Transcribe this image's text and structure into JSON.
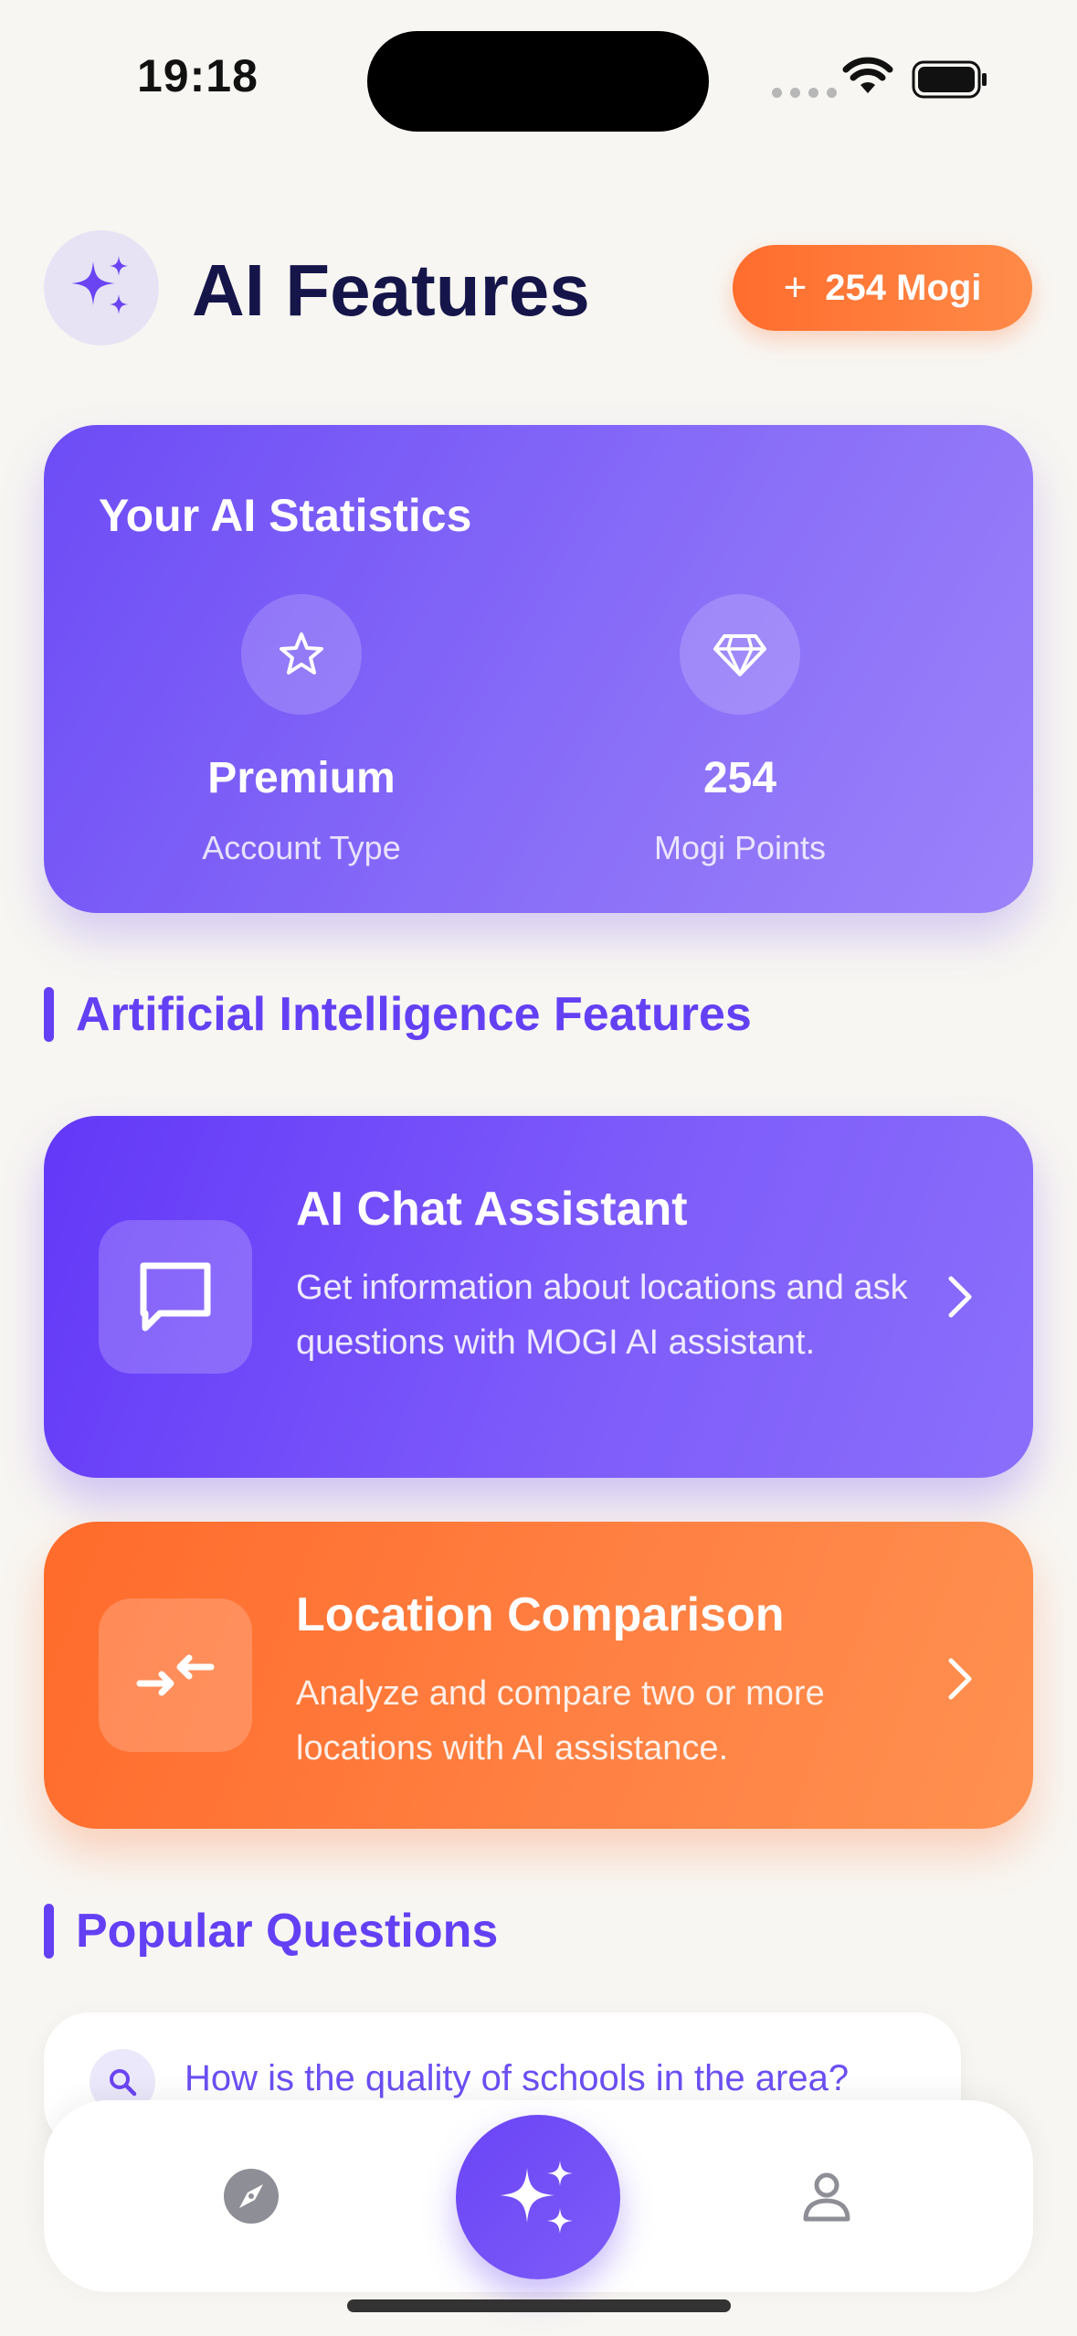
{
  "status_bar": {
    "time": "19:18"
  },
  "header": {
    "title": "AI Features",
    "mogi_button_label": "254 Mogi",
    "icon": "sparkles-icon"
  },
  "stats": {
    "title": "Your AI Statistics",
    "items": [
      {
        "icon": "star-icon",
        "value": "Premium",
        "label": "Account Type"
      },
      {
        "icon": "diamond-icon",
        "value": "254",
        "label": "Mogi Points"
      }
    ]
  },
  "sections": {
    "ai_features_title": "Artificial Intelligence Features",
    "popular_title": "Popular Questions"
  },
  "features": [
    {
      "icon": "chat-bubble-icon",
      "title": "AI Chat Assistant",
      "description": "Get information about locations and ask questions with MOGI AI assistant."
    },
    {
      "icon": "compare-arrows-icon",
      "title": "Location Comparison",
      "description": "Analyze and compare two or more locations with AI assistance."
    }
  ],
  "popular_questions": [
    {
      "icon": "search-icon",
      "text": "How is the quality of schools in the area?"
    }
  ],
  "bottom_nav": {
    "items": [
      "compass-icon",
      "sparkles-icon",
      "profile-icon"
    ]
  },
  "colors": {
    "accent_purple": "#6440f4",
    "accent_orange": "#ff6d2d",
    "background": "#f8f6f2",
    "title_navy": "#16154a"
  }
}
